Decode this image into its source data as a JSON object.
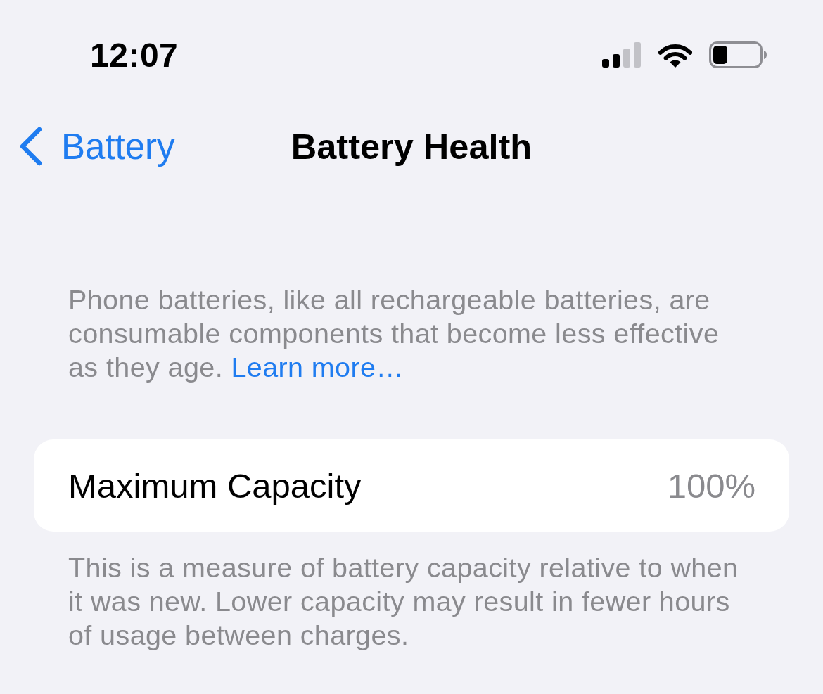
{
  "status_bar": {
    "time": "12:07"
  },
  "nav_bar": {
    "back_label": "Battery",
    "title": "Battery Health"
  },
  "intro": {
    "text": "Phone batteries, like all rechargeable batteries, are consumable components that become less effective as they age.",
    "link": "Learn more…"
  },
  "capacity_row": {
    "label": "Maximum Capacity",
    "value": "100%"
  },
  "footer": "This is a measure of battery capacity relative to when it was new. Lower capacity may result in fewer hours of usage between charges."
}
